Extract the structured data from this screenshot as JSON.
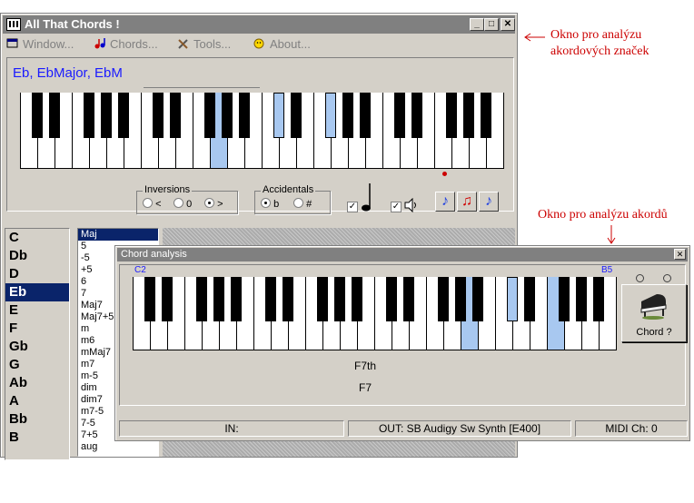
{
  "main_window": {
    "title": "All That Chords !",
    "controls": {
      "minimize": "_",
      "maximize": "□",
      "close": "✕"
    },
    "menu": [
      {
        "label": "Window...",
        "icon": "window-icon"
      },
      {
        "label": "Chords...",
        "icon": "notes-icon"
      },
      {
        "label": "Tools...",
        "icon": "tools-icon"
      },
      {
        "label": "About...",
        "icon": "smiley-icon"
      }
    ],
    "chord_names": "Eb, EbMajor, EbM",
    "keyboard": {
      "white_key_count": 28,
      "highlighted_white": [
        11
      ],
      "highlighted_black": [
        14,
        17
      ]
    },
    "inversions": {
      "label": "Inversions",
      "options": [
        "<",
        "0",
        ">"
      ],
      "selected": ">"
    },
    "accidentals": {
      "label": "Accidentals",
      "options": [
        "b",
        "#"
      ],
      "selected": "b"
    },
    "note_checkbox_checked": true,
    "sound_checkbox_checked": true,
    "roots": [
      "C",
      "Db",
      "D",
      "Eb",
      "E",
      "F",
      "Gb",
      "G",
      "Ab",
      "A",
      "Bb",
      "B"
    ],
    "selected_root": "Eb",
    "chord_types": [
      "Maj",
      "5",
      "-5",
      "+5",
      "6",
      "7",
      "Maj7",
      "Maj7+5",
      "m",
      "m6",
      "mMaj7",
      "m7",
      "m-5",
      "dim",
      "dim7",
      "m7-5",
      "7-5",
      "7+5",
      "aug"
    ],
    "selected_type": "Maj"
  },
  "analysis_window": {
    "title": "Chord analysis",
    "close": "✕",
    "range_start": "C2",
    "range_end": "B5",
    "keyboard": {
      "white_key_count": 28,
      "highlighted_white": [
        19,
        24
      ],
      "highlighted_black": [
        21
      ]
    },
    "chord_button_label": "Chord ?",
    "result_long": "F7th",
    "result_short": "F7",
    "status_in": "IN:",
    "status_out": "OUT: SB Audigy Sw Synth [E400]",
    "status_midi": "MIDI Ch: 0"
  },
  "annotations": {
    "top": [
      "Okno pro analýzu",
      "akordových značek"
    ],
    "bottom": "Okno pro analýzu akordů"
  },
  "colors": {
    "highlight_key": "#a8c8f0",
    "chord_text": "#1a1aff",
    "annotation": "#cc0000",
    "selection": "#0a246a"
  }
}
